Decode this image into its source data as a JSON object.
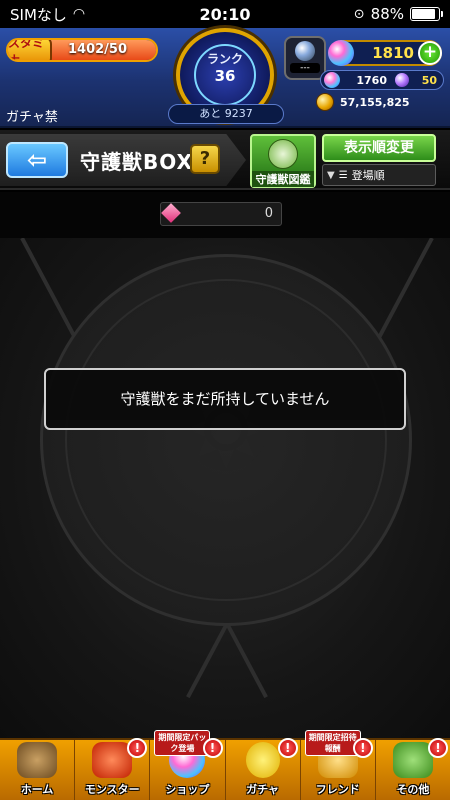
{
  "status_bar": {
    "carrier": "SIMなし",
    "time": "20:10",
    "battery": "88%",
    "battery_level": 0.88
  },
  "header": {
    "stamina_label": "スタミナ",
    "stamina_value": "1402/50",
    "stamina_fill": 1.0,
    "rank_label": "ランク",
    "rank_value": "36",
    "exp_remaining": "あと 9237",
    "dark_item_label": "---",
    "orbs_total": "1810",
    "orbs_free": "1760",
    "gems": "50",
    "gold": "57,155,825",
    "gacha_label": "ガチャ禁"
  },
  "titlebar": {
    "back_arrow": "⇦",
    "title": "守護獣BOX",
    "help": "?",
    "book_label": "守護獣図鑑",
    "sort_button": "表示順変更",
    "sort_current": "登場順"
  },
  "counter": {
    "value": "0"
  },
  "main": {
    "empty_message": "守護獣をまだ所持していません"
  },
  "bottom_nav": {
    "items": [
      {
        "label": "ホーム"
      },
      {
        "label": "モンスター",
        "badge": "!"
      },
      {
        "label": "ショップ",
        "promo": "期間限定パック登場",
        "badge": "!"
      },
      {
        "label": "ガチャ",
        "badge": "!"
      },
      {
        "label": "フレンド",
        "promo": "期間限定招待報酬",
        "badge": "!"
      },
      {
        "label": "その他",
        "badge": "!"
      }
    ]
  },
  "colors": {
    "accent_orange": "#f0a000",
    "header_blue": "#1c3270",
    "sort_green": "#2e8d1a",
    "back_blue": "#1f7ae0"
  }
}
